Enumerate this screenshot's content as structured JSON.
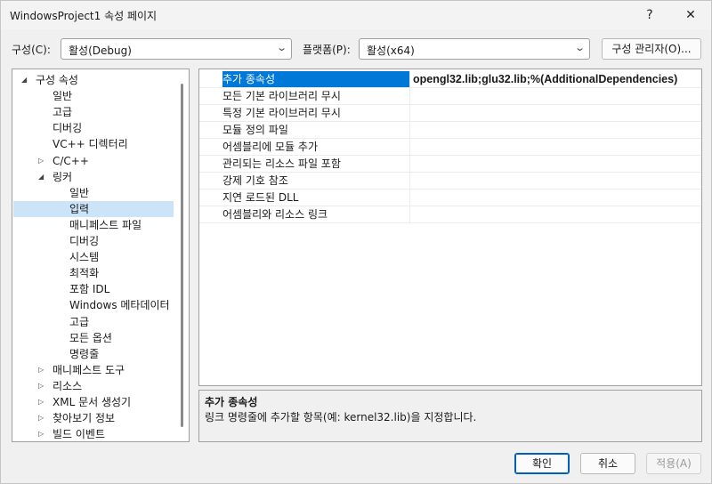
{
  "window": {
    "title": "WindowsProject1 속성 페이지",
    "help": "?",
    "close": "✕"
  },
  "config": {
    "label": "구성(C):",
    "value": "활성(Debug)"
  },
  "platform": {
    "label": "플랫폼(P):",
    "value": "활성(x64)"
  },
  "config_manager_label": "구성 관리자(O)...",
  "tree": [
    {
      "label": "구성 속성",
      "twisty": "◢"
    },
    {
      "label": "일반"
    },
    {
      "label": "고급"
    },
    {
      "label": "디버깅"
    },
    {
      "label": "VC++ 디렉터리"
    },
    {
      "label": "C/C++",
      "twisty": "▷"
    },
    {
      "label": "링커",
      "twisty": "◢"
    },
    {
      "label": "일반"
    },
    {
      "label": "입력",
      "selected": true
    },
    {
      "label": "매니페스트 파일"
    },
    {
      "label": "디버깅"
    },
    {
      "label": "시스템"
    },
    {
      "label": "최적화"
    },
    {
      "label": "포함 IDL"
    },
    {
      "label": "Windows 메타데이터"
    },
    {
      "label": "고급"
    },
    {
      "label": "모든 옵션"
    },
    {
      "label": "명령줄"
    },
    {
      "label": "매니페스트 도구",
      "twisty": "▷"
    },
    {
      "label": "리소스",
      "twisty": "▷"
    },
    {
      "label": "XML 문서 생성기",
      "twisty": "▷"
    },
    {
      "label": "찾아보기 정보",
      "twisty": "▷"
    },
    {
      "label": "빌드 이벤트",
      "twisty": "▷"
    }
  ],
  "properties": [
    {
      "name": "추가 종속성",
      "value": "opengl32.lib;glu32.lib;%(AdditionalDependencies)",
      "selected": true
    },
    {
      "name": "모든 기본 라이브러리 무시",
      "value": ""
    },
    {
      "name": "특정 기본 라이브러리 무시",
      "value": ""
    },
    {
      "name": "모듈 정의 파일",
      "value": ""
    },
    {
      "name": "어셈블리에 모듈 추가",
      "value": ""
    },
    {
      "name": "관리되는 리소스 파일 포함",
      "value": ""
    },
    {
      "name": "강제 기호 참조",
      "value": ""
    },
    {
      "name": "지연 로드된 DLL",
      "value": ""
    },
    {
      "name": "어셈블리와 리소스 링크",
      "value": ""
    }
  ],
  "description": {
    "title": "추가 종속성",
    "text": "링크 명령줄에 추가할 항목(예: kernel32.lib)을 지정합니다."
  },
  "buttons": {
    "ok": "확인",
    "cancel": "취소",
    "apply": "적용(A)"
  },
  "colors": {
    "selection": "#0078d7",
    "tree_selection": "#cce4f7"
  }
}
